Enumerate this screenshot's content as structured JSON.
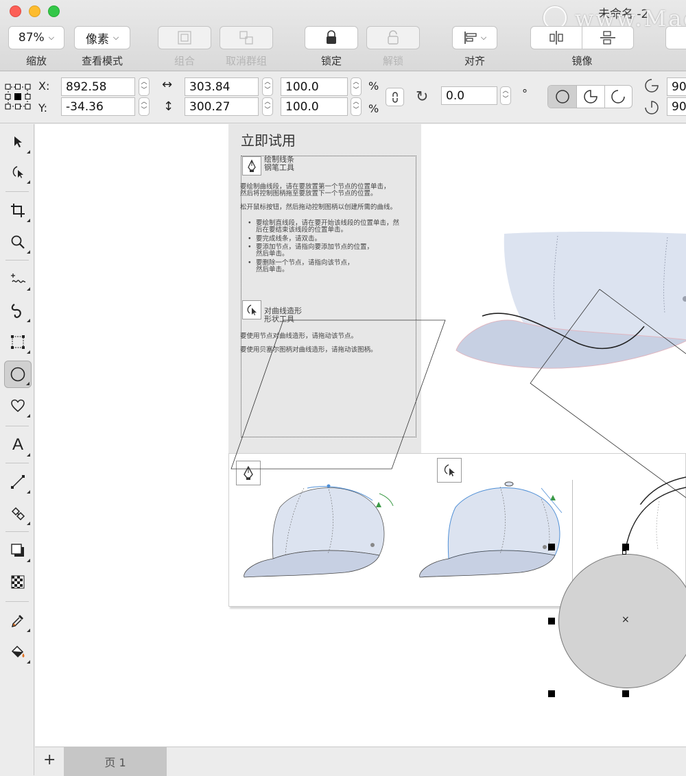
{
  "window": {
    "title": "未命名 -2",
    "watermark": "www.Mac"
  },
  "toolbar": {
    "zoom_value": "87%",
    "view_mode_value": "像素",
    "zoom_label": "缩放",
    "view_mode_label": "查看模式",
    "group_label": "组合",
    "ungroup_label": "取消群组",
    "lock_label": "锁定",
    "unlock_label": "解锁",
    "align_label": "对齐",
    "mirror_label": "镜像"
  },
  "props": {
    "x_label": "X:",
    "y_label": "Y:",
    "x_value": "892.58",
    "y_value": "-34.36",
    "width_value": "303.84",
    "height_value": "300.27",
    "scale_w_value": "100.0",
    "scale_h_value": "100.0",
    "percent": "%",
    "rotation_value": "0.0",
    "degree": "°",
    "angle1_value": "90",
    "angle2_value": "90"
  },
  "panel": {
    "title": "立即试用",
    "section1_line1": "绘制线条",
    "section1_line2": "钢笔工具",
    "p1a": "要绘制曲线段，请在要放置第一个节点的位置单击，",
    "p1b": "然后将控制图柄拖至要放置下一个节点的位置。",
    "p2": "松开鼠标按钮，然后拖动控制图柄以创建所需的曲线。",
    "b1a": "要绘制直线段，请在要开始该线段的位置单击，然",
    "b1b": "后在要结束该线段的位置单击。",
    "b2": "要完成线条，请双击。",
    "b3a": "要添加节点，请指向要添加节点的位置，",
    "b3b": "然后单击。",
    "b4a": "要删除一个节点，请指向该节点，",
    "b4b": "然后单击。",
    "section2_line1": "对曲线造形",
    "section2_line2": "形状工具",
    "p3": "要使用节点对曲线造形，请拖动该节点。",
    "p4": "要使用贝塞尔图柄对曲线造形，请拖动该图柄。"
  },
  "pages": {
    "add": "+",
    "page1": "页 1"
  },
  "colors": {
    "cap_fill": "#dce3f0",
    "cap_shade": "#c7d0e3",
    "ellipse_fill": "#d3d3d3",
    "accent_green": "#3c9a46",
    "node_blue": "#4f8fd6"
  },
  "icons": [
    "zoom-icon",
    "lock-icon",
    "unlock-icon",
    "align-icon",
    "mirror-horizontal-icon",
    "mirror-vertical-icon",
    "pick-tool-icon",
    "shape-tool-icon",
    "crop-tool-icon",
    "zoom-tool-icon",
    "freehand-tool-icon",
    "artistic-media-icon",
    "rectangle-tool-icon",
    "ellipse-tool-icon",
    "heart-shape-icon",
    "text-tool-icon",
    "line-tool-icon",
    "connector-tool-icon",
    "drop-shadow-icon",
    "transparency-icon",
    "eyedropper-icon",
    "fill-bucket-icon",
    "pen-tool-icon"
  ]
}
